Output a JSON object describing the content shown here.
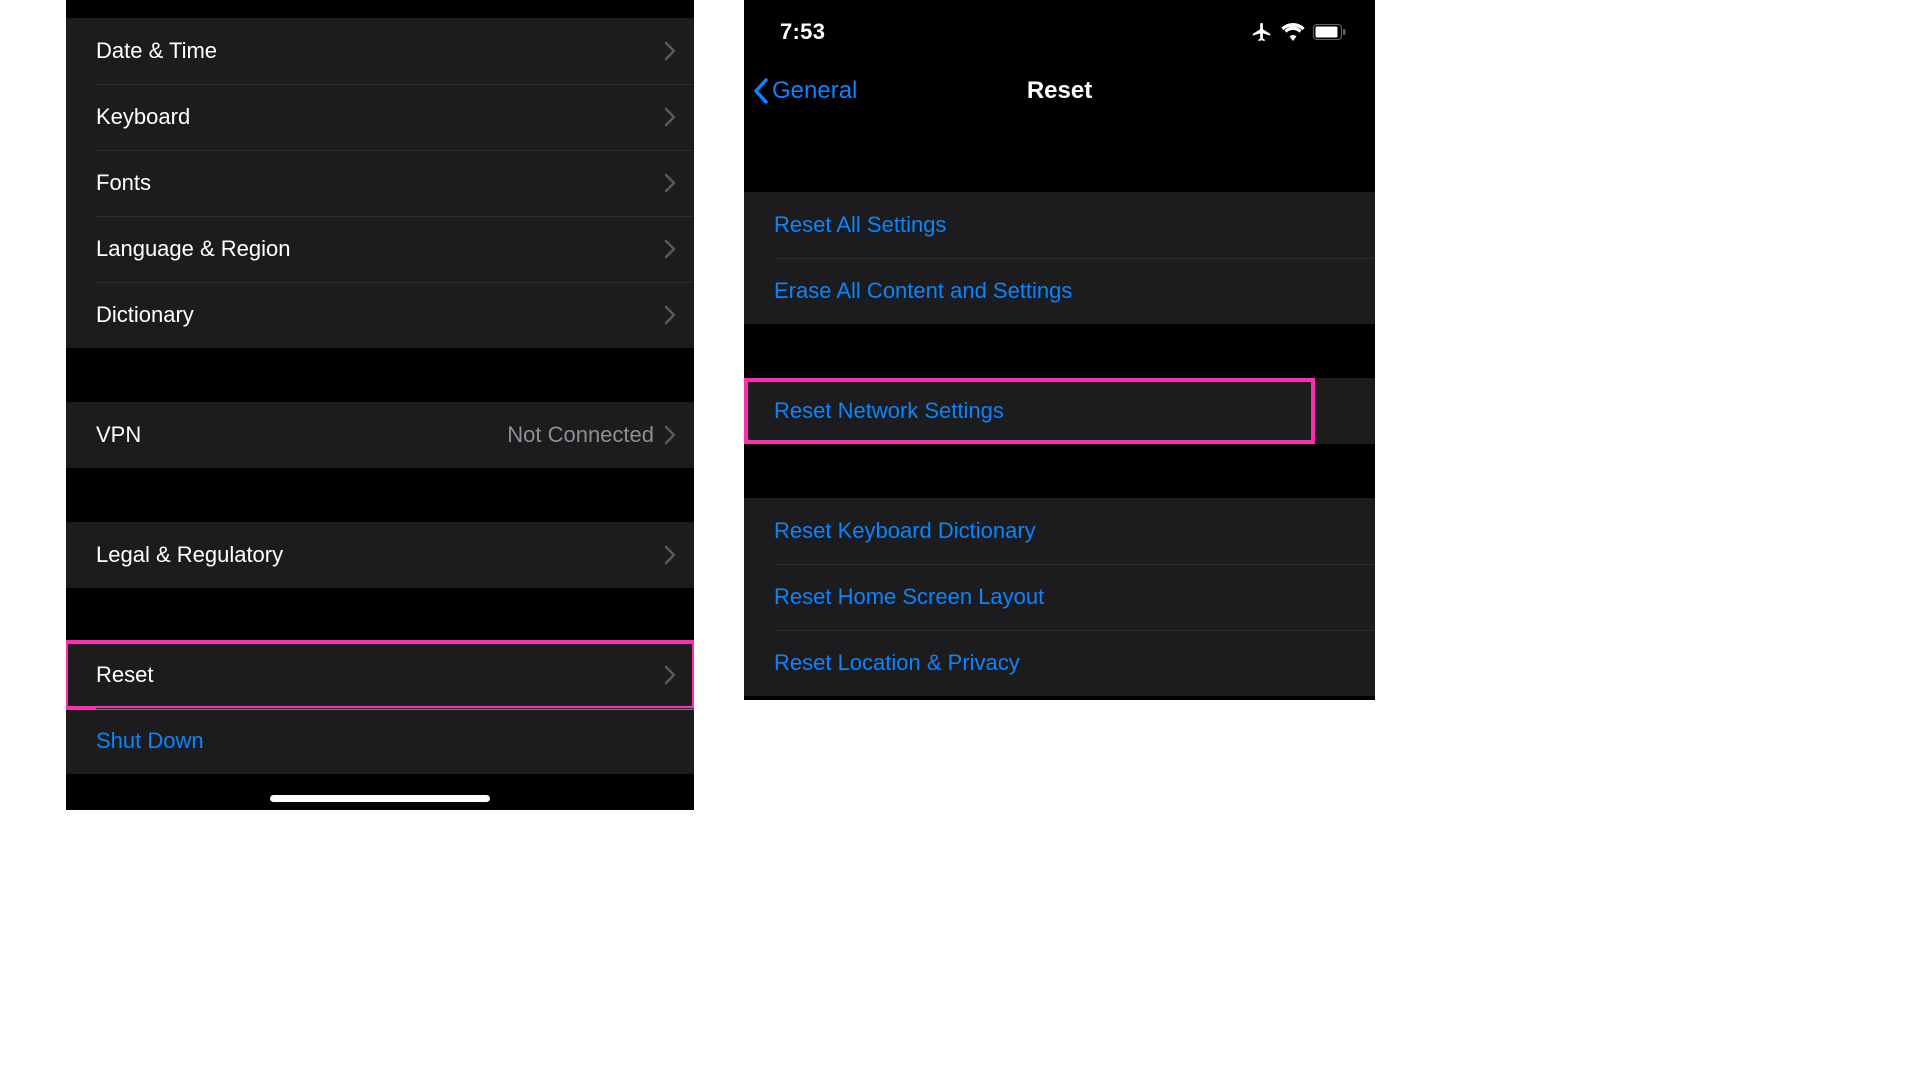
{
  "left": {
    "groups": {
      "general": [
        {
          "label": "Date & Time"
        },
        {
          "label": "Keyboard"
        },
        {
          "label": "Fonts"
        },
        {
          "label": "Language & Region"
        },
        {
          "label": "Dictionary"
        }
      ],
      "vpn": {
        "label": "VPN",
        "value": "Not Connected"
      },
      "legal": {
        "label": "Legal & Regulatory"
      },
      "reset": {
        "label": "Reset"
      },
      "shutdown": {
        "label": "Shut Down"
      }
    }
  },
  "right": {
    "status": {
      "time": "7:53"
    },
    "nav": {
      "back": "General",
      "title": "Reset"
    },
    "groups": {
      "top": [
        {
          "label": "Reset All Settings"
        },
        {
          "label": "Erase All Content and Settings"
        }
      ],
      "network": {
        "label": "Reset Network Settings"
      },
      "bottom": [
        {
          "label": "Reset Keyboard Dictionary"
        },
        {
          "label": "Reset Home Screen Layout"
        },
        {
          "label": "Reset Location & Privacy"
        }
      ]
    }
  },
  "colors": {
    "accent": "#0a84ff",
    "highlight": "#ff2eb0",
    "rowBg": "#1c1c1e",
    "secondaryText": "#8e8e93"
  }
}
